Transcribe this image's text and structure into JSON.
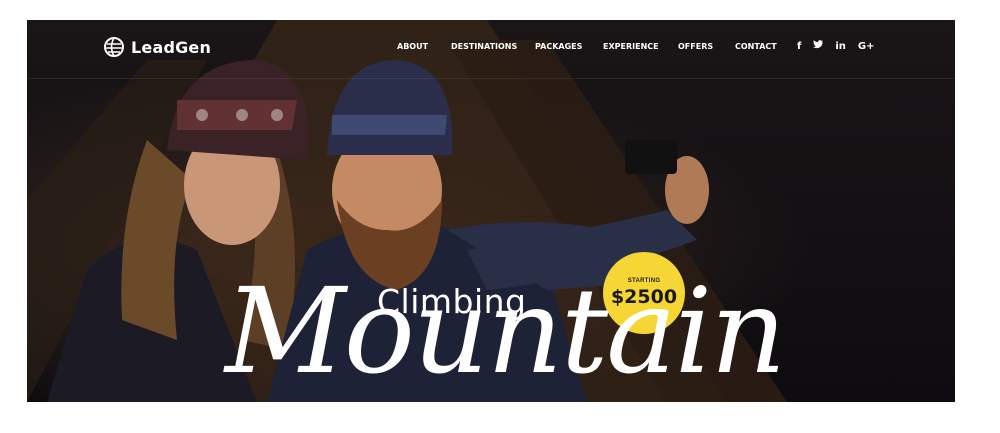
{
  "brand": {
    "name": "LeadGen",
    "icon": "globe-logo-icon"
  },
  "nav": {
    "items": [
      {
        "label": "ABOUT"
      },
      {
        "label": "DESTINATIONS"
      },
      {
        "label": "PACKAGES"
      },
      {
        "label": "EXPERIENCE"
      },
      {
        "label": "OFFERS"
      },
      {
        "label": "CONTACT"
      }
    ],
    "social": [
      {
        "label": "f",
        "icon": "facebook-icon"
      },
      {
        "label": "🐦",
        "icon": "twitter-icon"
      },
      {
        "label": "in",
        "icon": "linkedin-icon"
      },
      {
        "label": "G+",
        "icon": "google-plus-icon"
      }
    ]
  },
  "hero": {
    "subtitle": "Climbing",
    "title": "Mountain",
    "badge": {
      "label": "STARTING",
      "price": "$2500"
    }
  },
  "colors": {
    "accent": "#f5d634",
    "background": "#0e0c10",
    "text": "#ffffff"
  }
}
